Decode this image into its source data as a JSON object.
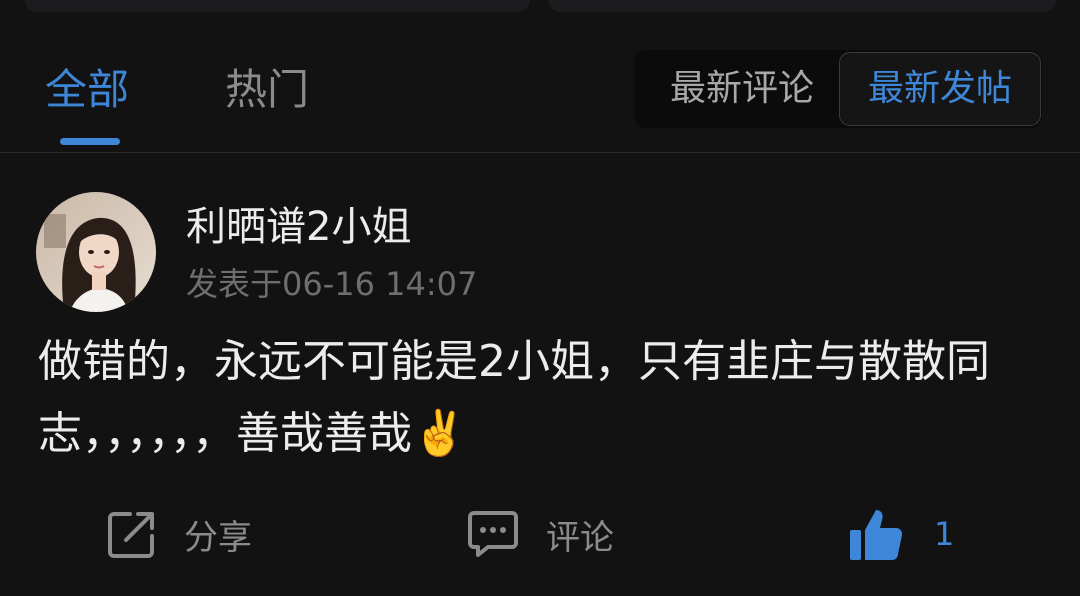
{
  "tabs": [
    {
      "label": "全部",
      "active": true
    },
    {
      "label": "热门",
      "active": false
    }
  ],
  "sort": {
    "options": [
      "最新评论",
      "最新发帖"
    ],
    "selected": "最新发帖"
  },
  "post": {
    "username": "利晒谱2小姐",
    "timestamp": "发表于06-16 14:07",
    "content": "做错的，永远不可能是2小姐，只有韭庄与散散同志，，，，，，善哉善哉✌️"
  },
  "actions": {
    "share_label": "分享",
    "comment_label": "评论",
    "like_count": "1"
  },
  "colors": {
    "accent": "#3e87d8",
    "background": "#121212",
    "text": "#ececec",
    "muted": "#8b8b8b"
  },
  "icons": [
    "share-icon",
    "comment-icon",
    "thumbs-up-icon"
  ]
}
